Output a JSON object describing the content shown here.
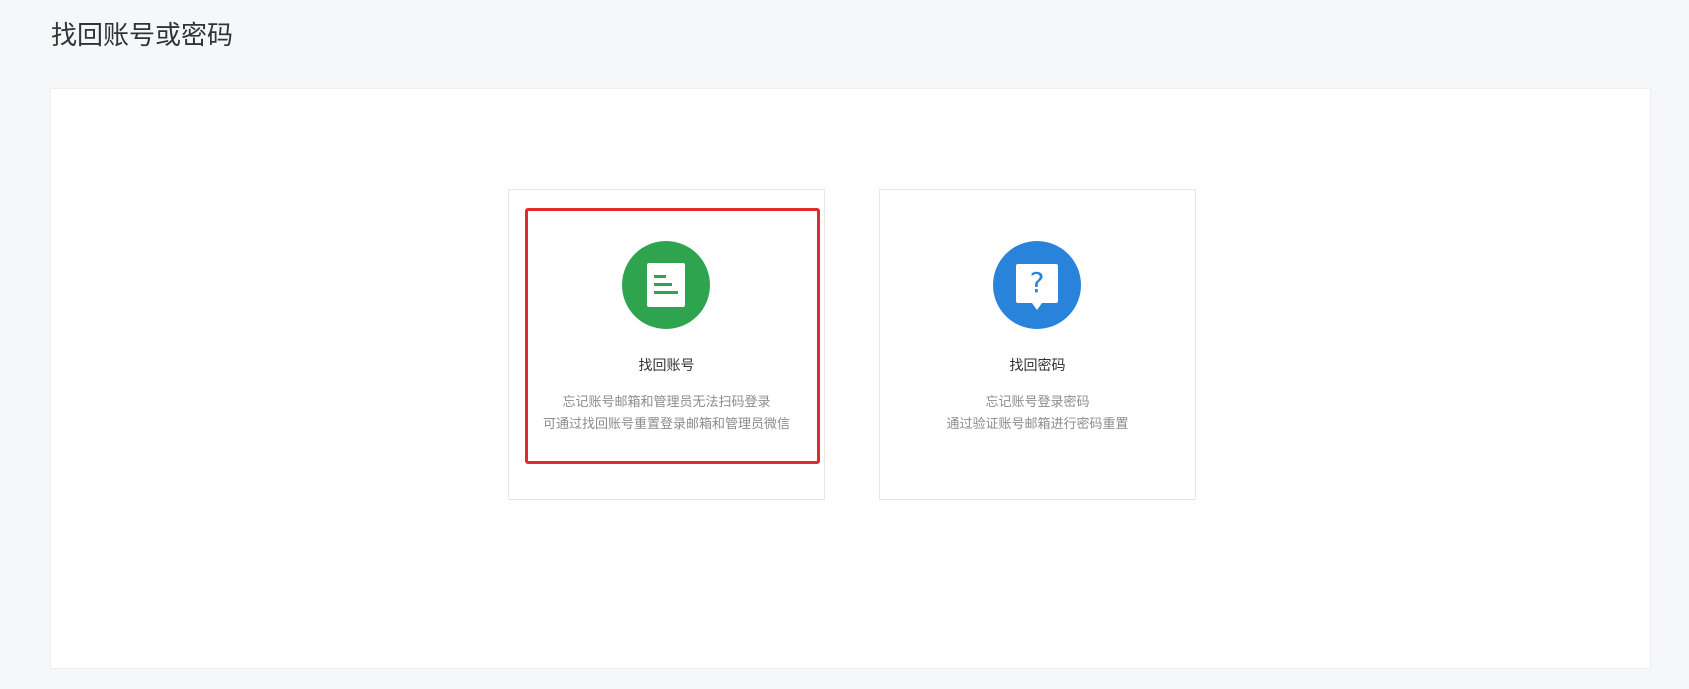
{
  "page": {
    "title": "找回账号或密码"
  },
  "cards": [
    {
      "title": "找回账号",
      "desc_line1": "忘记账号邮箱和管理员无法扫码登录",
      "desc_line2": "可通过找回账号重置登录邮箱和管理员微信",
      "icon": "document-icon",
      "color": "#2ea44f",
      "highlighted": true
    },
    {
      "title": "找回密码",
      "desc_line1": "忘记账号登录密码",
      "desc_line2": "通过验证账号邮箱进行密码重置",
      "icon": "question-bubble-icon",
      "color": "#2a83db",
      "highlighted": false
    }
  ],
  "colors": {
    "background": "#f6f7f9",
    "highlight_border": "#e02b2b"
  }
}
